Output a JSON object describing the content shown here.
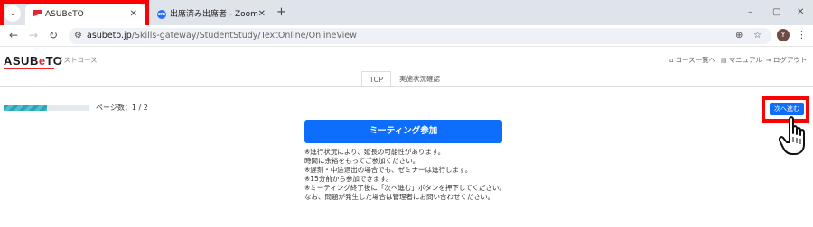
{
  "browser": {
    "tabs": [
      {
        "title": "ASUBeTO",
        "active": true
      },
      {
        "title": "出席済み出席者 - Zoom",
        "active": false
      }
    ],
    "favicon_zoom_text": "zm",
    "new_tab": "+",
    "window_controls": {
      "minimize": "–",
      "maximize": "▢",
      "close": "✕"
    },
    "url_domain": "asubeto.jp",
    "url_path": "/Skills-gateway/StudentStudy/TextOnline/OnlineView",
    "profile_initial": "Y"
  },
  "site": {
    "logo_prefix": "ASUB",
    "logo_e": "e",
    "logo_suffix": "TO",
    "course_name": "テストコース",
    "nav": {
      "course_list": "コース一覧へ",
      "manual": "マニュアル",
      "logout": "ログアウト"
    },
    "subtabs": [
      "TOP",
      "実施状況確認"
    ]
  },
  "content": {
    "progress_fraction": 0.5,
    "page_count": "ページ数：1 / 2",
    "meeting_button": "ミーティング参加",
    "notes": [
      "※進行状況により、延長の可能性があります。",
      "時間に余裕をもってご参加ください。",
      "※遅刻・中途退出の場合でも、ゼミナーは進行します。",
      "※15分前から参加できます。",
      "※ミーティング終了後に「次へ進む」ボタンを押下してください。",
      "なお、問題が発生した場合は管理者にお問い合わせください。"
    ],
    "next_button": "次へ進む"
  },
  "colors": {
    "primary_button": "#0d6efd",
    "highlight_box": "#ff0000",
    "logo_accent": "#e8262b",
    "progress": "#2aa6b6"
  },
  "icons": [
    "search-tabs-icon",
    "close-icon",
    "back-icon",
    "forward-icon",
    "reload-icon",
    "site-info-icon",
    "zoom-icon",
    "bookmark-star-icon",
    "menu-icon",
    "home-icon",
    "manual-icon",
    "logout-icon",
    "hand-pointer-icon"
  ]
}
